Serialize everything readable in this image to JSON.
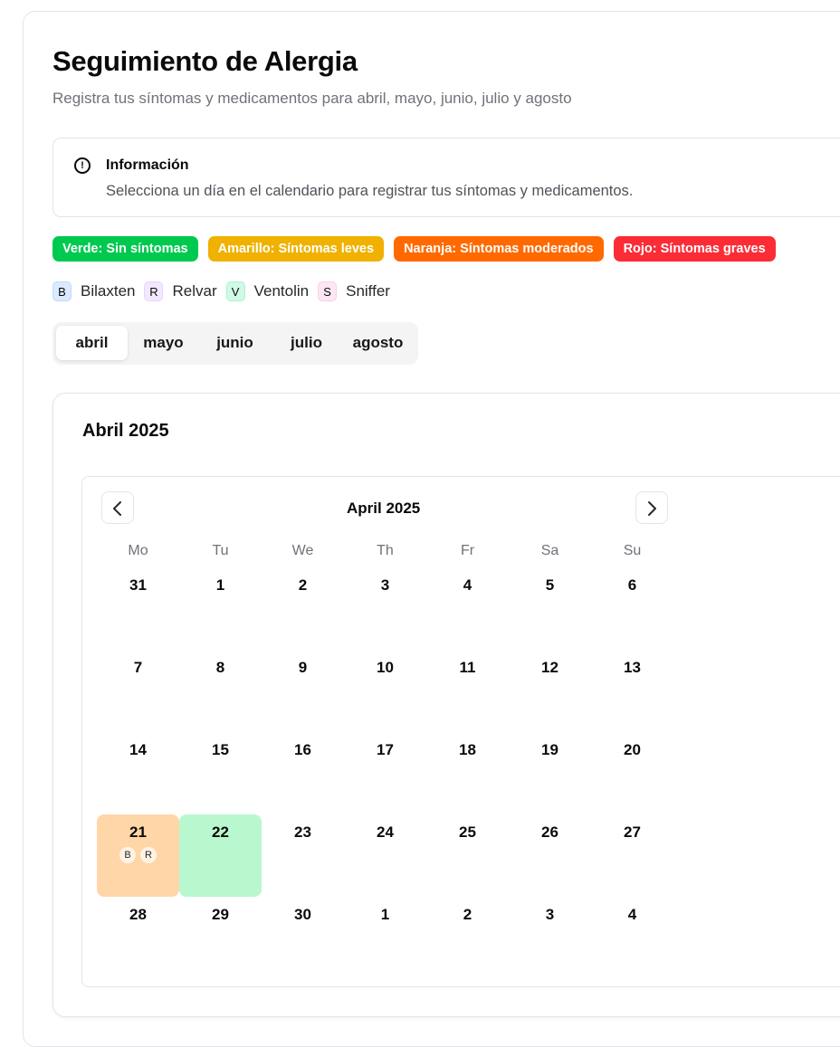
{
  "header": {
    "title": "Seguimiento de Alergia",
    "subtitle": "Registra tus síntomas y medicamentos para abril, mayo, junio, julio y agosto"
  },
  "info": {
    "icon": "info-circle-icon",
    "title": "Información",
    "text": "Selecciona un día en el calendario para registrar tus síntomas y medicamentos."
  },
  "legend": [
    {
      "label": "Verde: Sin síntomas",
      "color": "#00c950"
    },
    {
      "label": "Amarillo: Síntomas leves",
      "color": "#f0b100"
    },
    {
      "label": "Naranja: Síntomas moderados",
      "color": "#ff6900"
    },
    {
      "label": "Rojo: Síntomas graves",
      "color": "#fb2c36"
    }
  ],
  "medications": [
    {
      "code": "B",
      "label": "Bilaxten",
      "bg": "#dbeafe",
      "border": "#bfdbfe"
    },
    {
      "code": "R",
      "label": "Relvar",
      "bg": "#f3e8ff",
      "border": "#e9d5ff"
    },
    {
      "code": "V",
      "label": "Ventolin",
      "bg": "#d1fae5",
      "border": "#a7f3d0"
    },
    {
      "code": "S",
      "label": "Sniffer",
      "bg": "#fce7f3",
      "border": "#fbcfe8"
    }
  ],
  "tabs": [
    {
      "label": "abril",
      "active": true
    },
    {
      "label": "mayo",
      "active": false
    },
    {
      "label": "junio",
      "active": false
    },
    {
      "label": "julio",
      "active": false
    },
    {
      "label": "agosto",
      "active": false
    }
  ],
  "calendar": {
    "card_title": "Abril 2025",
    "month_label": "April 2025",
    "prev_icon": "chevron-left-icon",
    "next_icon": "chevron-right-icon",
    "weekdays": [
      "Mo",
      "Tu",
      "We",
      "Th",
      "Fr",
      "Sa",
      "Su"
    ],
    "weeks": [
      [
        {
          "d": "31"
        },
        {
          "d": "1"
        },
        {
          "d": "2"
        },
        {
          "d": "3"
        },
        {
          "d": "4"
        },
        {
          "d": "5"
        },
        {
          "d": "6"
        }
      ],
      [
        {
          "d": "7"
        },
        {
          "d": "8"
        },
        {
          "d": "9"
        },
        {
          "d": "10"
        },
        {
          "d": "11"
        },
        {
          "d": "12"
        },
        {
          "d": "13"
        }
      ],
      [
        {
          "d": "14"
        },
        {
          "d": "15"
        },
        {
          "d": "16"
        },
        {
          "d": "17"
        },
        {
          "d": "18"
        },
        {
          "d": "19"
        },
        {
          "d": "20"
        }
      ],
      [
        {
          "d": "21",
          "color": "#ffd6a8",
          "meds": [
            "B",
            "R"
          ]
        },
        {
          "d": "22",
          "color": "#b9f8cf"
        },
        {
          "d": "23"
        },
        {
          "d": "24"
        },
        {
          "d": "25"
        },
        {
          "d": "26"
        },
        {
          "d": "27"
        }
      ],
      [
        {
          "d": "28"
        },
        {
          "d": "29"
        },
        {
          "d": "30"
        },
        {
          "d": "1"
        },
        {
          "d": "2"
        },
        {
          "d": "3"
        },
        {
          "d": "4"
        }
      ]
    ]
  }
}
